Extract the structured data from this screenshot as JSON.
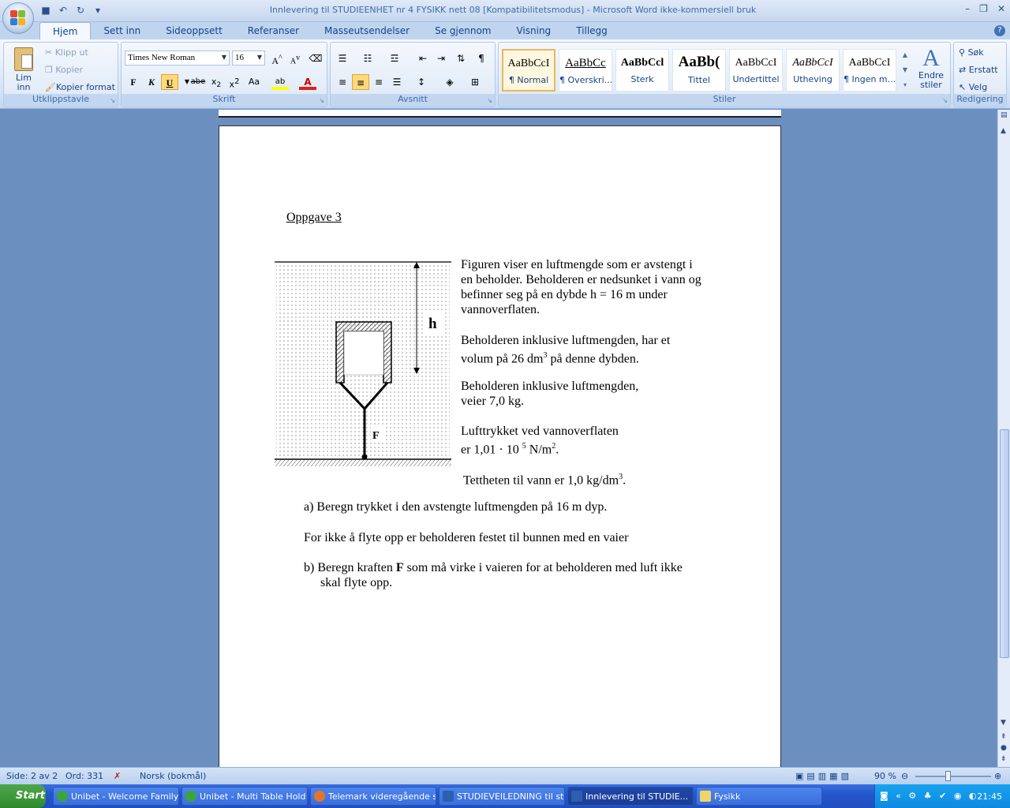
{
  "window": {
    "title": "Innlevering til STUDIEENHET nr 4  FYSIKK nett 08 [Kompatibilitetsmodus] - Microsoft Word ikke-kommersiell bruk"
  },
  "tabs": [
    "Hjem",
    "Sett inn",
    "Sideoppsett",
    "Referanser",
    "Masseutsendelser",
    "Se gjennom",
    "Visning",
    "Tillegg"
  ],
  "clipboard": {
    "paste": "Lim inn",
    "cut": "Klipp ut",
    "copy": "Kopier",
    "format_painter": "Kopier format",
    "label": "Utklippstavle"
  },
  "font": {
    "name": "Times New Roman",
    "size": "16",
    "label": "Skrift"
  },
  "paragraph": {
    "label": "Avsnitt"
  },
  "styles": {
    "label": "Stiler",
    "items": [
      {
        "sample": "AaBbCcI",
        "name": "¶ Normal"
      },
      {
        "sample": "AaBbCc",
        "name": "¶ Overskri..."
      },
      {
        "sample": "AaBbCcl",
        "name": "Sterk"
      },
      {
        "sample": "AaBb(",
        "name": "Tittel"
      },
      {
        "sample": "AaBbCcI",
        "name": "Undertittel"
      },
      {
        "sample": "AaBbCcI",
        "name": "Utheving"
      },
      {
        "sample": "AaBbCcI",
        "name": "¶ Ingen m..."
      }
    ],
    "change": "Endre stiler"
  },
  "editing": {
    "find": "Søk",
    "replace": "Erstatt",
    "select": "Velg",
    "label": "Redigering"
  },
  "document": {
    "heading": "Oppgave 3",
    "para1": [
      "Figuren viser en luftmengde som er avstengt i",
      "en beholder. Beholderen er nedsunket i vann og",
      "befinner seg på en dybde  h = 16 m under",
      "vannoverflaten."
    ],
    "para2": [
      "Beholderen inklusive luftmengden, har et",
      "volum på 26 dm",
      "3",
      " på denne dybden."
    ],
    "para3": [
      "Beholderen inklusive luftmengden,",
      "veier 7,0 kg."
    ],
    "para4": [
      "Lufttrykket ved vannoverflaten",
      "er 1,01 · 10 ",
      "5",
      " N/m",
      "2",
      "."
    ],
    "para5": [
      "Tettheten til vann er 1,0 kg/dm",
      "3",
      "."
    ],
    "qa": "a)  Beregn trykket i den avstengte luftmengden på 16 m dyp.",
    "mid": "For ikke å flyte opp er beholderen festet til bunnen med en vaier",
    "qb1": "b)  Beregn kraften ",
    "qb_bold": "F",
    "qb2": " som må virke i vaieren for at beholderen med luft ikke",
    "qb3": "skal flyte opp.",
    "fig_h": "h",
    "fig_f": "F"
  },
  "status": {
    "page": "Side: 2 av 2",
    "words": "Ord: 331",
    "language": "Norsk (bokmål)",
    "zoom": "90 %"
  },
  "taskbar": {
    "start": "Start",
    "tasks": [
      "Unibet - Welcome Family...",
      "Unibet - Multi Table Hold ...",
      "Telemark videregående s...",
      "STUDIEVEILEDNING til st...",
      "Innlevering til STUDIE...",
      "Fysikk"
    ],
    "clock": "21:45"
  }
}
